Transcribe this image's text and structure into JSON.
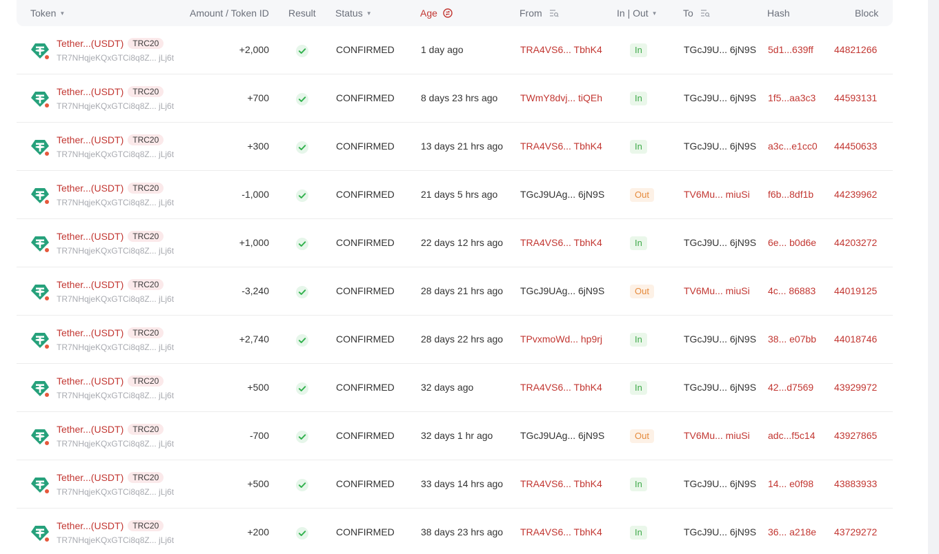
{
  "header": {
    "token": "Token",
    "amount": "Amount / Token ID",
    "result": "Result",
    "status": "Status",
    "age": "Age",
    "from": "From",
    "inout": "In | Out",
    "to": "To",
    "hash": "Hash",
    "block": "Block"
  },
  "colors": {
    "accent_red": "#c23631",
    "in_green": "#3faa4a",
    "out_orange": "#e58a3c",
    "tether_green": "#26a17b"
  },
  "rows": [
    {
      "token": "Tether...(USDT)",
      "badge": "TRC20",
      "addr": "TR7NHqjeKQxGTCi8q8Z... jLj6t",
      "amount": "+2,000",
      "status": "CONFIRMED",
      "age": "1 day ago",
      "from": "TRA4VS6... TbhK4",
      "from_red": true,
      "dir": "In",
      "to": "TGcJ9U... 6jN9S",
      "to_red": false,
      "hash": "5d1...639ff",
      "block": "44821266"
    },
    {
      "token": "Tether...(USDT)",
      "badge": "TRC20",
      "addr": "TR7NHqjeKQxGTCi8q8Z... jLj6t",
      "amount": "+700",
      "status": "CONFIRMED",
      "age": "8 days 23 hrs ago",
      "from": "TWmY8dvj... tiQEh",
      "from_red": true,
      "dir": "In",
      "to": "TGcJ9U... 6jN9S",
      "to_red": false,
      "hash": "1f5...aa3c3",
      "block": "44593131"
    },
    {
      "token": "Tether...(USDT)",
      "badge": "TRC20",
      "addr": "TR7NHqjeKQxGTCi8q8Z... jLj6t",
      "amount": "+300",
      "status": "CONFIRMED",
      "age": "13 days 21 hrs ago",
      "from": "TRA4VS6... TbhK4",
      "from_red": true,
      "dir": "In",
      "to": "TGcJ9U... 6jN9S",
      "to_red": false,
      "hash": "a3c...e1cc0",
      "block": "44450633"
    },
    {
      "token": "Tether...(USDT)",
      "badge": "TRC20",
      "addr": "TR7NHqjeKQxGTCi8q8Z... jLj6t",
      "amount": "-1,000",
      "status": "CONFIRMED",
      "age": "21 days 5 hrs ago",
      "from": "TGcJ9UAg... 6jN9S",
      "from_red": false,
      "dir": "Out",
      "to": "TV6Mu... miuSi",
      "to_red": true,
      "hash": "f6b...8df1b",
      "block": "44239962"
    },
    {
      "token": "Tether...(USDT)",
      "badge": "TRC20",
      "addr": "TR7NHqjeKQxGTCi8q8Z... jLj6t",
      "amount": "+1,000",
      "status": "CONFIRMED",
      "age": "22 days 12 hrs ago",
      "from": "TRA4VS6... TbhK4",
      "from_red": true,
      "dir": "In",
      "to": "TGcJ9U... 6jN9S",
      "to_red": false,
      "hash": "6e... b0d6e",
      "block": "44203272"
    },
    {
      "token": "Tether...(USDT)",
      "badge": "TRC20",
      "addr": "TR7NHqjeKQxGTCi8q8Z... jLj6t",
      "amount": "-3,240",
      "status": "CONFIRMED",
      "age": "28 days 21 hrs ago",
      "from": "TGcJ9UAg... 6jN9S",
      "from_red": false,
      "dir": "Out",
      "to": "TV6Mu... miuSi",
      "to_red": true,
      "hash": "4c... 86883",
      "block": "44019125"
    },
    {
      "token": "Tether...(USDT)",
      "badge": "TRC20",
      "addr": "TR7NHqjeKQxGTCi8q8Z... jLj6t",
      "amount": "+2,740",
      "status": "CONFIRMED",
      "age": "28 days 22 hrs ago",
      "from": "TPvxmoWd... hp9rj",
      "from_red": true,
      "dir": "In",
      "to": "TGcJ9U... 6jN9S",
      "to_red": false,
      "hash": "38... e07bb",
      "block": "44018746"
    },
    {
      "token": "Tether...(USDT)",
      "badge": "TRC20",
      "addr": "TR7NHqjeKQxGTCi8q8Z... jLj6t",
      "amount": "+500",
      "status": "CONFIRMED",
      "age": "32 days ago",
      "from": "TRA4VS6... TbhK4",
      "from_red": true,
      "dir": "In",
      "to": "TGcJ9U... 6jN9S",
      "to_red": false,
      "hash": "42...d7569",
      "block": "43929972"
    },
    {
      "token": "Tether...(USDT)",
      "badge": "TRC20",
      "addr": "TR7NHqjeKQxGTCi8q8Z... jLj6t",
      "amount": "-700",
      "status": "CONFIRMED",
      "age": "32 days 1 hr ago",
      "from": "TGcJ9UAg... 6jN9S",
      "from_red": false,
      "dir": "Out",
      "to": "TV6Mu... miuSi",
      "to_red": true,
      "hash": "adc...f5c14",
      "block": "43927865"
    },
    {
      "token": "Tether...(USDT)",
      "badge": "TRC20",
      "addr": "TR7NHqjeKQxGTCi8q8Z... jLj6t",
      "amount": "+500",
      "status": "CONFIRMED",
      "age": "33 days 14 hrs ago",
      "from": "TRA4VS6... TbhK4",
      "from_red": true,
      "dir": "In",
      "to": "TGcJ9U... 6jN9S",
      "to_red": false,
      "hash": "14... e0f98",
      "block": "43883933"
    },
    {
      "token": "Tether...(USDT)",
      "badge": "TRC20",
      "addr": "TR7NHqjeKQxGTCi8q8Z... jLj6t",
      "amount": "+200",
      "status": "CONFIRMED",
      "age": "38 days 23 hrs ago",
      "from": "TRA4VS6... TbhK4",
      "from_red": true,
      "dir": "In",
      "to": "TGcJ9U... 6jN9S",
      "to_red": false,
      "hash": "36... a218e",
      "block": "43729272"
    }
  ]
}
